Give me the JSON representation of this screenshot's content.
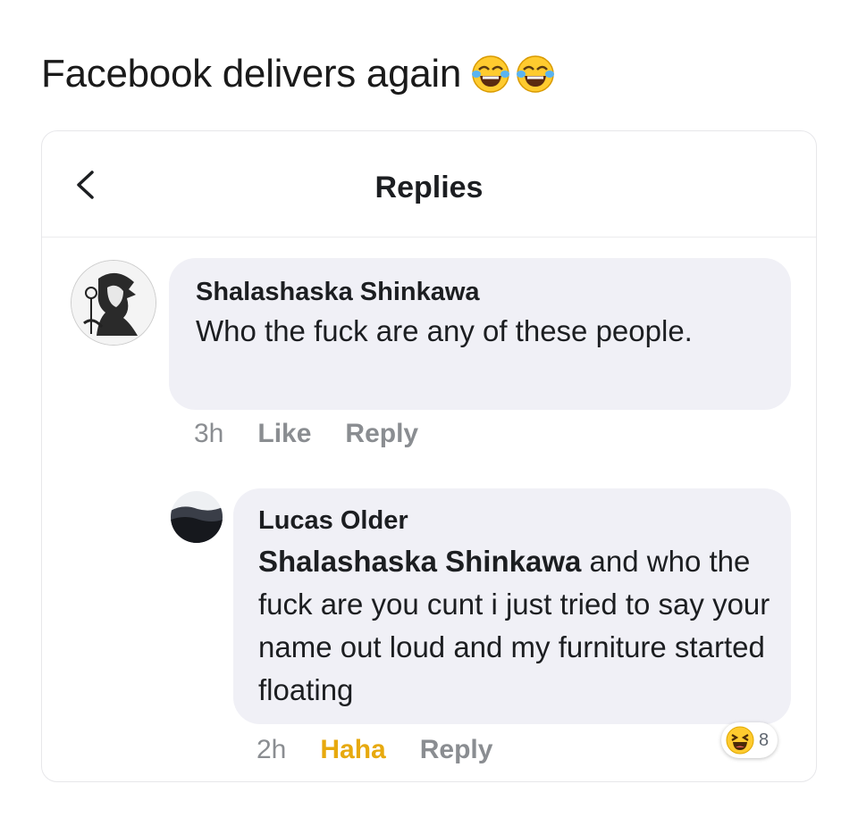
{
  "caption": {
    "text": "Facebook delivers again",
    "emojis": [
      "face-with-tears-of-joy-icon",
      "face-with-tears-of-joy-icon"
    ]
  },
  "header": {
    "title": "Replies",
    "back_icon": "chevron-left-icon"
  },
  "comments": [
    {
      "author": "Shalashaska Shinkawa",
      "text": "Who the fuck are any of these people.",
      "time": "3h",
      "like_label": "Like",
      "reply_label": "Reply"
    },
    {
      "author": "Lucas Older",
      "mention": "Shalashaska Shinkawa",
      "text": " and who the fuck are you cunt i just tried to say your name out loud and my furniture started floating",
      "time": "2h",
      "reaction_label": "Haha",
      "reply_label": "Reply",
      "reactions": {
        "icon": "haha-reaction-icon",
        "count": "8"
      }
    }
  ],
  "colors": {
    "bubble": "#f0f0f6",
    "meta_text": "#8a8d91",
    "haha": "#e7a90e"
  }
}
